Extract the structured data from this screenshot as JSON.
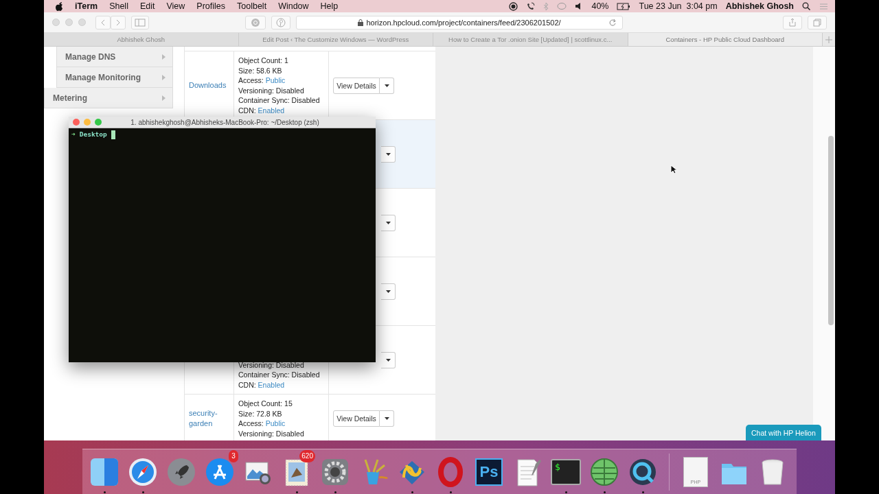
{
  "menu_bar": {
    "app": "iTerm",
    "menus": [
      "Shell",
      "Edit",
      "View",
      "Profiles",
      "Toolbelt",
      "Window",
      "Help"
    ],
    "battery": "40%",
    "datetime": "Tue 23 Jun  3:04 pm",
    "user": "Abhishek Ghosh"
  },
  "browser": {
    "url": "horizon.hpcloud.com/project/containers/feed/2306201502/",
    "tabs": [
      {
        "title": "Abhishek Ghosh",
        "selected": false
      },
      {
        "title": "Edit Post ‹ The Customize Windows — WordPress",
        "selected": false
      },
      {
        "title": "How to Create a Tor .onion Site [Updated] | scottlinux.c...",
        "selected": false
      },
      {
        "title": "Containers - HP Public Cloud Dashboard",
        "selected": true
      }
    ]
  },
  "sidebar": {
    "items": [
      {
        "label": "Manage DNS",
        "kind": "sub"
      },
      {
        "label": "Manage Monitoring",
        "kind": "sub"
      },
      {
        "label": "Metering",
        "kind": "top"
      }
    ]
  },
  "containers": {
    "rows": [
      {
        "name": "Downloads",
        "highlighted": false,
        "details": [
          {
            "text": "Object Count: 1"
          },
          {
            "text": "Size: 58.6 KB"
          },
          {
            "text": "Access:",
            "link": "Public"
          },
          {
            "text": "Versioning: Disabled"
          },
          {
            "text": "Container Sync: Disabled"
          },
          {
            "text": "CDN:",
            "link": "Enabled"
          }
        ],
        "button": "View Details"
      },
      {
        "highlighted": true
      },
      {
        "highlighted": false
      },
      {
        "highlighted": false
      },
      {
        "highlighted": false,
        "details": [
          {
            "text": "Versioning: Disabled"
          },
          {
            "text": "Container Sync: Disabled"
          },
          {
            "text": "CDN:",
            "link": "Enabled"
          }
        ]
      },
      {
        "name": "security-garden",
        "highlighted": false,
        "details": [
          {
            "text": "Object Count: 15"
          },
          {
            "text": "Size: 72.8 KB"
          },
          {
            "text": "Access:",
            "link": "Public"
          },
          {
            "text": "Versioning: Disabled"
          }
        ],
        "button": "View Details"
      }
    ]
  },
  "chat_button": "Chat with HP Helion",
  "terminal": {
    "title": "1. abhishekghosh@Abhisheks-MacBook-Pro: ~/Desktop (zsh)",
    "prompt_symbol": "➜",
    "directory": "Desktop"
  },
  "dock": {
    "items": [
      {
        "kind": "finder",
        "running": true
      },
      {
        "kind": "safari",
        "running": true
      },
      {
        "kind": "launchpad",
        "running": false
      },
      {
        "kind": "appstore",
        "running": false,
        "badge": "3"
      },
      {
        "kind": "preview",
        "running": false
      },
      {
        "kind": "mail",
        "running": true,
        "badge": "620"
      },
      {
        "kind": "prefs",
        "running": true
      },
      {
        "kind": "brush",
        "running": false
      },
      {
        "kind": "knot",
        "running": true
      },
      {
        "kind": "opera",
        "running": true
      },
      {
        "kind": "ps",
        "running": false,
        "label": "Ps"
      },
      {
        "kind": "notes",
        "running": false
      },
      {
        "kind": "terminal",
        "running": true,
        "label": "$"
      },
      {
        "kind": "globe",
        "running": true
      },
      {
        "kind": "quicktime",
        "running": true
      },
      {
        "kind": "separator"
      },
      {
        "kind": "document",
        "running": false,
        "label": "PHP"
      },
      {
        "kind": "folder",
        "running": false
      },
      {
        "kind": "trash",
        "running": false
      }
    ]
  }
}
